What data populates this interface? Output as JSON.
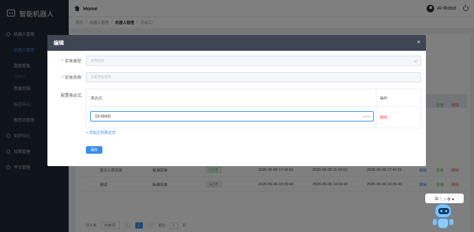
{
  "sidebar": {
    "logo_text": "智能机器人",
    "items": [
      {
        "label": "机器人管理",
        "type": "menu"
      },
      {
        "label": "机器人管理",
        "type": "sub",
        "active": true
      },
      {
        "label": "数据看板",
        "type": "sub"
      },
      {
        "label": "管理中心",
        "type": "group"
      },
      {
        "label": "数据挖掘",
        "type": "sub"
      },
      {
        "label": "标注中心",
        "type": "sub"
      },
      {
        "label": "敏感词管理",
        "type": "sub"
      },
      {
        "label": "知识中心",
        "type": "menu"
      },
      {
        "label": "权限管理",
        "type": "menu"
      },
      {
        "label": "平台管理",
        "type": "menu"
      }
    ]
  },
  "topbar": {
    "home": "Home",
    "user": "AI-Robot"
  },
  "breadcrumb": [
    "首页",
    "机器人管理",
    "机器人管理",
    "对话工厂"
  ],
  "table": {
    "rows": [
      {
        "name": "显示人员实体",
        "type": "标准实体",
        "status": "已启用",
        "created": "2026-06-08 17:42:51",
        "updated": "2026-06-06 11:42:00",
        "modified": "2026-06-08 17:42:51",
        "op1": "编辑",
        "op2": "查看",
        "op3": "删除"
      },
      {
        "name": "测试",
        "type": "标准实体",
        "status": "未启用",
        "created": "2026-06-06 19:29:43",
        "updated": "2026-06-06 19:29:43",
        "modified": "2026-06-06 19:29:43",
        "op1": "编辑",
        "op2": "查看",
        "op3": "删除"
      }
    ],
    "header_ops": {
      "op2": "查看",
      "op3": "删除"
    }
  },
  "pagination": {
    "total": "共 6 条",
    "page_size": "20条/页",
    "current_page": "1",
    "goto_label": "前往",
    "goto_value": "1",
    "page_unit": "页"
  },
  "modal": {
    "title": "编辑",
    "close": "×",
    "entity_type_label": "实体类型:",
    "entity_type_placeholder": "正则实体",
    "entity_name_label": "实体名称:",
    "entity_name_placeholder": "手机号码实体",
    "config_label": "配置表达式:",
    "col_expression": "表达式",
    "col_operation": "操作",
    "expression_value": "1[3-9]\\d{9}",
    "expression_count": "11/100",
    "delete_label": "删除",
    "add_link": "+ 添加正则表达式",
    "save_button": "保存"
  },
  "assistant_bar": "中 °, ♪ ⚙ ●"
}
